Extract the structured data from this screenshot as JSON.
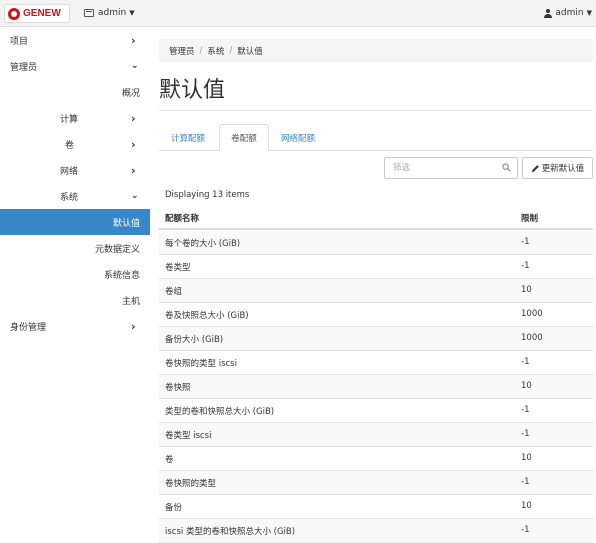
{
  "topbar": {
    "brand": "GENEW",
    "project": "admin",
    "user": "admin"
  },
  "sidebar": {
    "items": [
      {
        "label": "项目"
      },
      {
        "label": "管理员"
      },
      {
        "label": "概况"
      },
      {
        "label": "计算"
      },
      {
        "label": "卷"
      },
      {
        "label": "网络"
      },
      {
        "label": "系统"
      },
      {
        "label": "默认值"
      },
      {
        "label": "元数据定义"
      },
      {
        "label": "系统信息"
      },
      {
        "label": "主机"
      },
      {
        "label": "身份管理"
      }
    ]
  },
  "breadcrumb": {
    "items": [
      "管理员",
      "系统",
      "默认值"
    ],
    "separator": "/"
  },
  "page": {
    "title": "默认值"
  },
  "tabs": [
    {
      "label": "计算配额"
    },
    {
      "label": "卷配额"
    },
    {
      "label": "网络配额"
    }
  ],
  "toolbar": {
    "filter_placeholder": "筛选",
    "update_label": "更新默认值"
  },
  "table": {
    "count_text": "Displaying 13 items",
    "columns": [
      "配额名称",
      "限制"
    ],
    "rows": [
      {
        "name": "每个卷的大小 (GiB)",
        "limit": "-1"
      },
      {
        "name": "卷类型",
        "limit": "-1"
      },
      {
        "name": "卷组",
        "limit": "10"
      },
      {
        "name": "卷及快照总大小 (GiB)",
        "limit": "1000"
      },
      {
        "name": "备份大小 (GiB)",
        "limit": "1000"
      },
      {
        "name": "卷快照的类型 iscsi",
        "limit": "-1"
      },
      {
        "name": "卷快照",
        "limit": "10"
      },
      {
        "name": "类型的卷和快照总大小 (GiB)",
        "limit": "-1"
      },
      {
        "name": "卷类型 iscsi",
        "limit": "-1"
      },
      {
        "name": "卷",
        "limit": "10"
      },
      {
        "name": "卷快照的类型",
        "limit": "-1"
      },
      {
        "name": "备份",
        "limit": "10"
      },
      {
        "name": "iscsi 类型的卷和快照总大小 (GiB)",
        "limit": "-1"
      }
    ]
  },
  "colors": {
    "active": "#3a87c8",
    "brand": "#c8161d"
  }
}
